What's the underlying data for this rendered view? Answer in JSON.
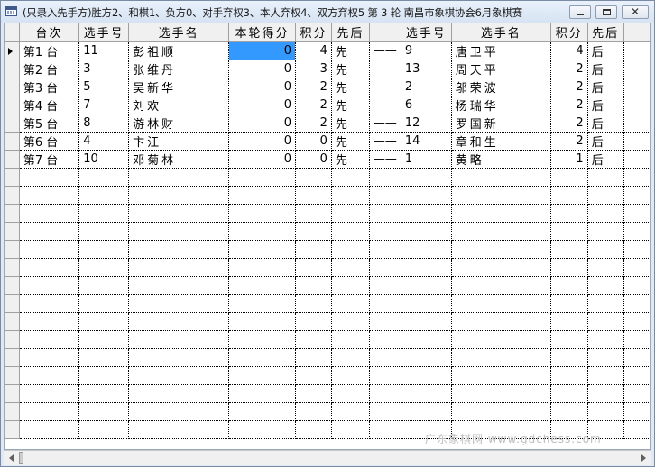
{
  "window": {
    "title": "(只录入先手方)胜方2、和棋1、负方0、对手弃权3、本人弃权4、双方弃权5  第 3 轮 南昌市象棋协会6月象棋赛",
    "minimize_label": "",
    "maximize_label": "",
    "close_label": "✕"
  },
  "table": {
    "headers": [
      "台次",
      "选手号",
      "选手名",
      "本轮得分",
      "积分",
      "先后",
      "",
      "选手号",
      "选手名",
      "积分",
      "先后"
    ],
    "rows": [
      {
        "table_no": "第1  台",
        "p1_id": "11",
        "p1_name": "彭祖顺",
        "round_score": "0",
        "p1_points": "4",
        "p1_order": "先",
        "sep": "——",
        "p2_id": "9",
        "p2_name": "唐卫平",
        "p2_points": "4",
        "p2_order": "后"
      },
      {
        "table_no": "第2  台",
        "p1_id": "3",
        "p1_name": "张维丹",
        "round_score": "0",
        "p1_points": "3",
        "p1_order": "先",
        "sep": "——",
        "p2_id": "13",
        "p2_name": "周天平",
        "p2_points": "2",
        "p2_order": "后"
      },
      {
        "table_no": "第3  台",
        "p1_id": "5",
        "p1_name": "吴新华",
        "round_score": "0",
        "p1_points": "2",
        "p1_order": "先",
        "sep": "——",
        "p2_id": "2",
        "p2_name": "邬荣波",
        "p2_points": "2",
        "p2_order": "后"
      },
      {
        "table_no": "第4  台",
        "p1_id": "7",
        "p1_name": "刘欢",
        "round_score": "0",
        "p1_points": "2",
        "p1_order": "先",
        "sep": "——",
        "p2_id": "6",
        "p2_name": "杨瑞华",
        "p2_points": "2",
        "p2_order": "后"
      },
      {
        "table_no": "第5  台",
        "p1_id": "8",
        "p1_name": "游林财",
        "round_score": "0",
        "p1_points": "2",
        "p1_order": "先",
        "sep": "——",
        "p2_id": "12",
        "p2_name": "罗国新",
        "p2_points": "2",
        "p2_order": "后"
      },
      {
        "table_no": "第6  台",
        "p1_id": "4",
        "p1_name": "卞江",
        "round_score": "0",
        "p1_points": "0",
        "p1_order": "先",
        "sep": "——",
        "p2_id": "14",
        "p2_name": "章和生",
        "p2_points": "2",
        "p2_order": "后"
      },
      {
        "table_no": "第7  台",
        "p1_id": "10",
        "p1_name": "邓菊林",
        "round_score": "0",
        "p1_points": "0",
        "p1_order": "先",
        "sep": "——",
        "p2_id": "1",
        "p2_name": "黄略",
        "p2_points": "1",
        "p2_order": "后"
      }
    ],
    "empty_rows": 15
  },
  "watermark": "广东象棋网  www.gdchess.com"
}
